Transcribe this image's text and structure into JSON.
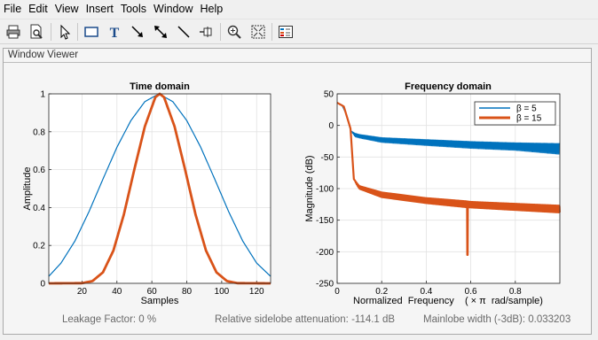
{
  "menu": [
    "File",
    "Edit",
    "View",
    "Insert",
    "Tools",
    "Window",
    "Help"
  ],
  "toolbar": {
    "icons": [
      "print-icon",
      "print-preview-icon",
      "select-arrow-icon",
      "rectangle-icon",
      "text-icon",
      "arrow-icon",
      "double-arrow-icon",
      "line-icon",
      "pin-icon",
      "zoom-in-icon",
      "fit-to-figure-icon",
      "legend-icon"
    ]
  },
  "panel": {
    "title": "Window Viewer"
  },
  "colors": {
    "beta5": "#0072bd",
    "beta15": "#d95319"
  },
  "chart_data": [
    {
      "type": "line",
      "title": "Time domain",
      "xlabel": "Samples",
      "ylabel": "Amplitude",
      "xlim": [
        1,
        128
      ],
      "ylim": [
        0,
        1
      ],
      "xticks": [
        20,
        40,
        60,
        80,
        100,
        120
      ],
      "yticks": [
        0,
        0.2,
        0.4,
        0.6,
        0.8,
        1
      ],
      "grid": true,
      "series": [
        {
          "name": "β = 5",
          "x": [
            1,
            8,
            16,
            24,
            32,
            40,
            48,
            56,
            64,
            72,
            80,
            88,
            96,
            104,
            112,
            120,
            128
          ],
          "values": [
            0.037,
            0.107,
            0.224,
            0.378,
            0.55,
            0.718,
            0.859,
            0.959,
            1.0,
            0.959,
            0.859,
            0.718,
            0.55,
            0.378,
            0.224,
            0.107,
            0.037
          ]
        },
        {
          "name": "β = 15",
          "x": [
            1,
            20,
            26,
            32,
            38,
            44,
            50,
            56,
            62,
            64.5,
            67,
            73,
            79,
            85,
            91,
            97,
            103,
            109,
            128
          ],
          "values": [
            0.0,
            0.001,
            0.012,
            0.058,
            0.173,
            0.364,
            0.602,
            0.828,
            0.982,
            1.0,
            0.982,
            0.828,
            0.602,
            0.364,
            0.173,
            0.058,
            0.012,
            0.001,
            0.0
          ]
        }
      ]
    },
    {
      "type": "line",
      "title": "Frequency domain",
      "xlabel": "Normalized  Frequency    ( × π  rad/sample)",
      "ylabel": "Magnitude (dB)",
      "xlim": [
        0,
        1
      ],
      "ylim": [
        -250,
        50
      ],
      "xticks": [
        0,
        0.2,
        0.4,
        0.6,
        0.8
      ],
      "yticks": [
        -250,
        -200,
        -150,
        -100,
        -50,
        0,
        50
      ],
      "grid": true,
      "legend": "top-right",
      "series": [
        {
          "name": "β = 5",
          "envelope_x": [
            0,
            0.02,
            0.04,
            0.06,
            0.08,
            0.1,
            0.2,
            0.4,
            0.6,
            0.8,
            1.0
          ],
          "envelope_peak": [
            36,
            33,
            18,
            -8,
            -12,
            -14,
            -19,
            -22,
            -25,
            -27,
            -28
          ],
          "envelope_floor": [
            36,
            33,
            18,
            -8,
            -28,
            -30,
            -40,
            -48,
            -55,
            -60,
            -75
          ]
        },
        {
          "name": "β = 15",
          "envelope_x": [
            0,
            0.03,
            0.06,
            0.075,
            0.09,
            0.1,
            0.2,
            0.4,
            0.58,
            0.6,
            0.8,
            1.0
          ],
          "envelope_peak": [
            36,
            30,
            -5,
            -85,
            -92,
            -96,
            -106,
            -115,
            -120,
            -121,
            -124,
            -127
          ],
          "envelope_floor": [
            36,
            30,
            -5,
            -85,
            -98,
            -105,
            -122,
            -132,
            -140,
            -140,
            -145,
            -150
          ],
          "dip_x": 0.585,
          "dip_value": -205
        }
      ]
    }
  ],
  "stats": {
    "leakage": "Leakage Factor: 0 %",
    "sidelobe": "Relative sidelobe attenuation: -114.1 dB",
    "mainlobe": "Mainlobe width (-3dB): 0.033203"
  }
}
